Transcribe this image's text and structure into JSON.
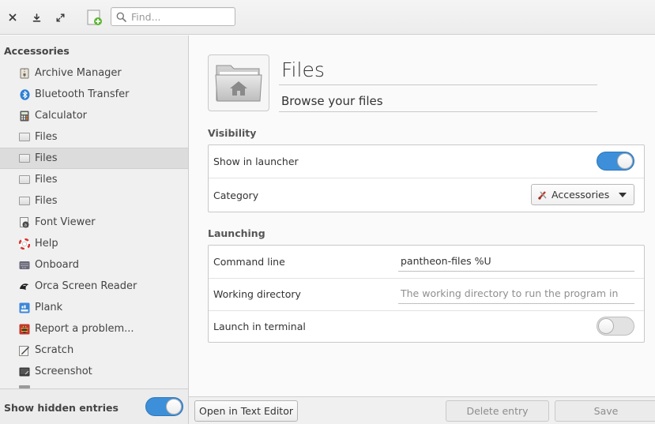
{
  "toolbar": {
    "close_icon": "close-icon",
    "download_icon": "download-icon",
    "expand_icon": "expand-icon",
    "new_icon": "new-document-icon",
    "search_placeholder": "Find..."
  },
  "sidebar": {
    "header": "Accessories",
    "items": [
      {
        "label": "Archive Manager",
        "icon": "archive-icon"
      },
      {
        "label": "Bluetooth Transfer",
        "icon": "bluetooth-icon"
      },
      {
        "label": "Calculator",
        "icon": "calculator-icon"
      },
      {
        "label": "Files",
        "icon": "folder-icon"
      },
      {
        "label": "Files",
        "icon": "folder-icon",
        "selected": true
      },
      {
        "label": "Files",
        "icon": "folder-icon"
      },
      {
        "label": "Files",
        "icon": "folder-icon"
      },
      {
        "label": "Font Viewer",
        "icon": "font-icon"
      },
      {
        "label": "Help",
        "icon": "help-icon"
      },
      {
        "label": "Onboard",
        "icon": "keyboard-icon"
      },
      {
        "label": "Orca Screen Reader",
        "icon": "orca-icon"
      },
      {
        "label": "Plank",
        "icon": "plank-icon"
      },
      {
        "label": "Report a problem...",
        "icon": "bug-report-icon"
      },
      {
        "label": "Scratch",
        "icon": "scratch-icon"
      },
      {
        "label": "Screenshot",
        "icon": "screenshot-icon"
      }
    ],
    "footer_label": "Show hidden entries",
    "show_hidden": true
  },
  "main": {
    "app_name": "Files",
    "app_comment": "Browse your files",
    "visibility": {
      "title": "Visibility",
      "show_in_launcher_label": "Show in launcher",
      "show_in_launcher": true,
      "category_label": "Category",
      "category_value": "Accessories"
    },
    "launching": {
      "title": "Launching",
      "command_line_label": "Command line",
      "command_line_value": "pantheon-files %U",
      "working_dir_label": "Working directory",
      "working_dir_placeholder": "The working directory to run the program in",
      "launch_terminal_label": "Launch in terminal",
      "launch_terminal": false
    }
  },
  "actions": {
    "open_editor": "Open in Text Editor",
    "delete_entry": "Delete entry",
    "save": "Save"
  },
  "colors": {
    "accent": "#3d8fd9"
  }
}
